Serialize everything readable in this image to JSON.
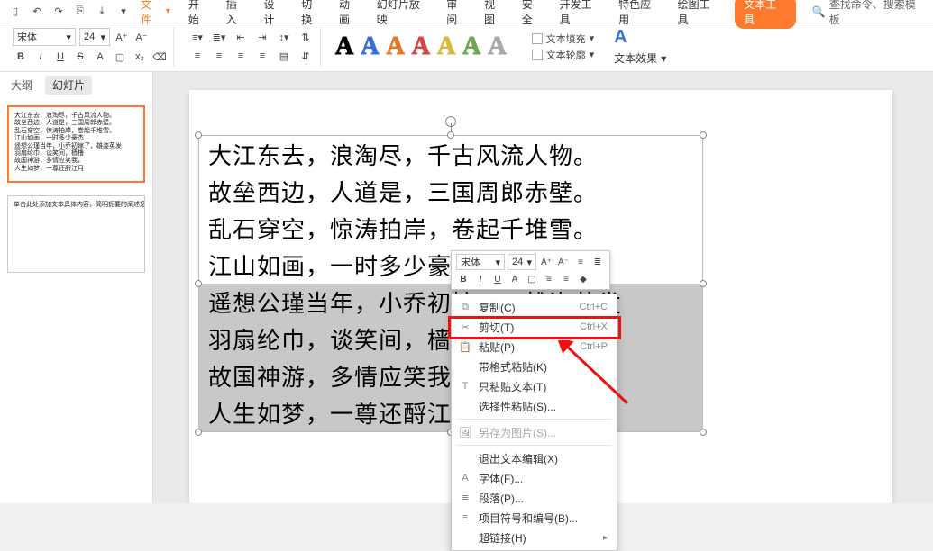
{
  "titlebar": {
    "file_menu": "文件",
    "dropdown_glyph": "▾"
  },
  "menu": {
    "items": [
      "开始",
      "插入",
      "设计",
      "切换",
      "动画",
      "幻灯片放映",
      "审阅",
      "视图",
      "安全",
      "开发工具",
      "特色应用",
      "绘图工具",
      "文本工具"
    ],
    "active_index": 12
  },
  "search": {
    "placeholder": "查找命令、搜索模板",
    "icon": "🔍"
  },
  "ribbon": {
    "font_name": "宋体",
    "font_size": "24",
    "big_A_colors": [
      "#000000",
      "#3a6fd8",
      "#e07a2a",
      "#d64545",
      "#d9b83f",
      "#6fa84f",
      "#a8a8a8"
    ],
    "text_fill": "文本填充",
    "text_outline": "文本轮廓",
    "text_effects": "文本效果"
  },
  "panel": {
    "tab_outline": "大纲",
    "tab_slides": "幻灯片",
    "thumb2_text": "单击此处添加文本具体内容，简明扼要的阐述您的观点。"
  },
  "poem": {
    "lines": [
      "大江东去，浪淘尽，千古风流人物。",
      "故垒西边，人道是，三国周郎赤壁。",
      "乱石穿空，惊涛拍岸，卷起千堆雪。",
      "江山如画，一时多少豪杰",
      "遥想公瑾当年，小乔初嫁了，雄姿英发",
      "羽扇纶巾，谈笑间，樯橹",
      "故国神游，多情应笑我，",
      "人生如梦，一尊还酹江月"
    ],
    "selected_from": 4
  },
  "mini_toolbar": {
    "font_name": "宋体",
    "font_size": "24"
  },
  "context_menu": {
    "items": [
      {
        "icon": "⧉",
        "label": "复制(C)",
        "shortcut": "Ctrl+C"
      },
      {
        "icon": "✂",
        "label": "剪切(T)",
        "shortcut": "Ctrl+X",
        "highlight": true
      },
      {
        "icon": "📋",
        "label": "粘贴(P)",
        "shortcut": "Ctrl+P"
      },
      {
        "icon": "",
        "label": "带格式粘贴(K)",
        "shortcut": ""
      },
      {
        "icon": "T",
        "label": "只粘贴文本(T)",
        "shortcut": ""
      },
      {
        "icon": "",
        "label": "选择性粘贴(S)...",
        "shortcut": ""
      },
      {
        "sep": true
      },
      {
        "icon": "🖼",
        "label": "另存为图片(S)...",
        "shortcut": "",
        "disabled": true
      },
      {
        "sep": true
      },
      {
        "icon": "",
        "label": "退出文本编辑(X)",
        "shortcut": ""
      },
      {
        "icon": "A",
        "label": "字体(F)...",
        "shortcut": ""
      },
      {
        "icon": "≣",
        "label": "段落(P)...",
        "shortcut": ""
      },
      {
        "icon": "≡",
        "label": "项目符号和编号(B)...",
        "shortcut": ""
      },
      {
        "icon": "",
        "label": "超链接(H)",
        "shortcut": "",
        "arrow": true
      }
    ]
  }
}
